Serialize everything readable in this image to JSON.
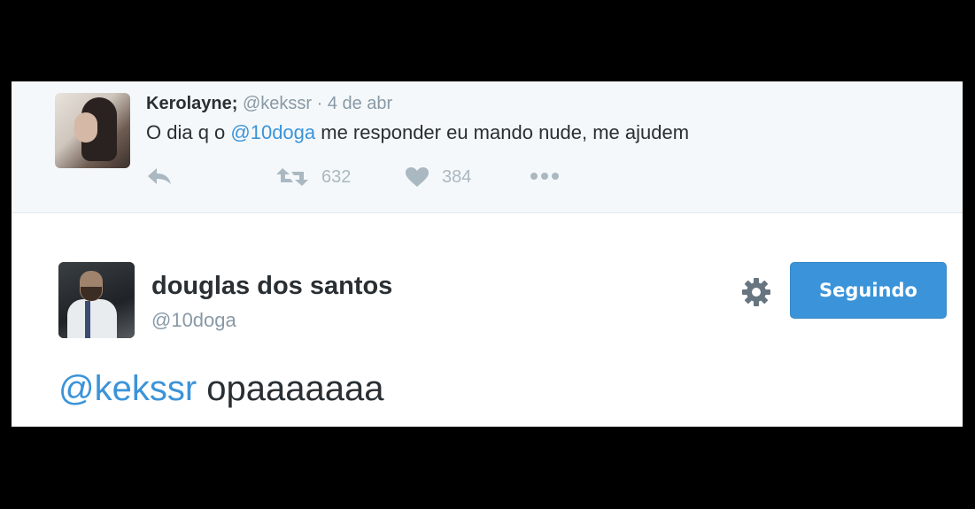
{
  "reply_tweet": {
    "display_name": "Kerolayne;",
    "handle": "@kekssr",
    "separator": "·",
    "date": "4 de abr",
    "text_before": "O dia q o ",
    "mention": "@10doga",
    "text_after": " me responder eu mando nude, me ajudem",
    "retweet_count": "632",
    "like_count": "384",
    "icons": [
      "reply-icon",
      "retweet-icon",
      "like-icon",
      "more-icon"
    ]
  },
  "main_tweet": {
    "display_name": "douglas dos santos",
    "handle": "@10doga",
    "follow_label": "Seguindo",
    "mention": "@kekssr",
    "text": " opaaaaaaa",
    "icons": [
      "gear-icon"
    ]
  },
  "colors": {
    "accent": "#3b94d9",
    "text": "#292f33",
    "muted": "#8899a6",
    "icon": "#aab8c2",
    "reply_bg": "#f5f8fa"
  }
}
